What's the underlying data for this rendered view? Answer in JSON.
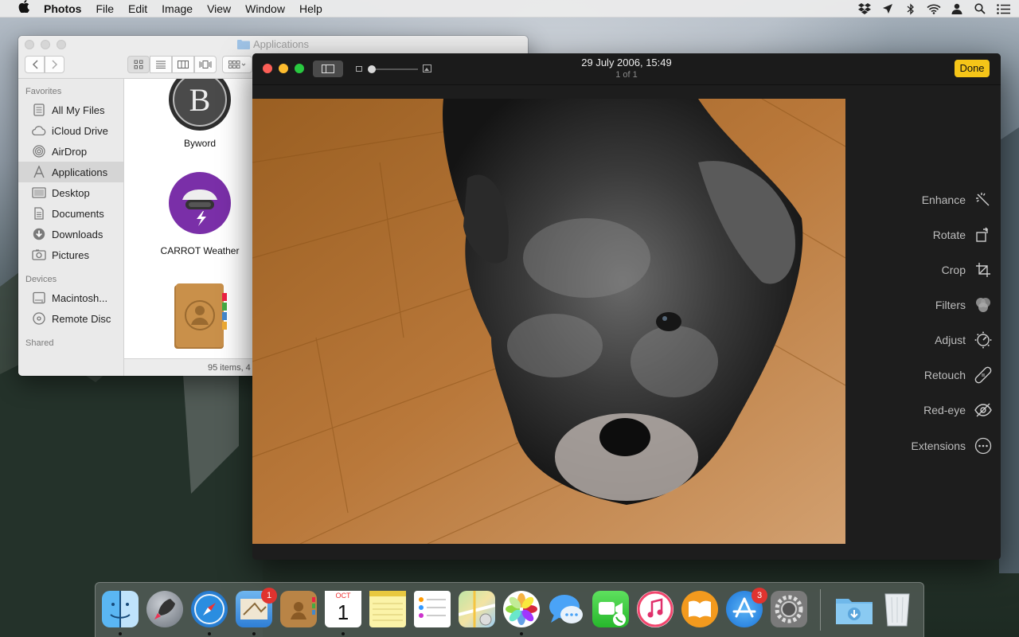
{
  "menubar": {
    "app_name": "Photos",
    "items": [
      "File",
      "Edit",
      "Image",
      "View",
      "Window",
      "Help"
    ],
    "status_icons": [
      "dropbox-icon",
      "location-icon",
      "bluetooth-icon",
      "wifi-icon",
      "user-icon",
      "spotlight-icon",
      "notification-center-icon"
    ]
  },
  "finder": {
    "title": "Applications",
    "sidebar": {
      "favorites_header": "Favorites",
      "favorites": [
        {
          "label": "All My Files",
          "icon": "all-files-icon"
        },
        {
          "label": "iCloud Drive",
          "icon": "cloud-icon"
        },
        {
          "label": "AirDrop",
          "icon": "airdrop-icon"
        },
        {
          "label": "Applications",
          "icon": "applications-icon"
        },
        {
          "label": "Desktop",
          "icon": "desktop-icon"
        },
        {
          "label": "Documents",
          "icon": "documents-icon"
        },
        {
          "label": "Downloads",
          "icon": "downloads-icon"
        },
        {
          "label": "Pictures",
          "icon": "pictures-icon"
        }
      ],
      "devices_header": "Devices",
      "devices": [
        {
          "label": "Macintosh...",
          "icon": "disk-icon"
        },
        {
          "label": "Remote Disc",
          "icon": "remote-disc-icon"
        }
      ],
      "shared_header": "Shared"
    },
    "apps": [
      {
        "label": "Byword",
        "icon": "byword-icon"
      },
      {
        "label": "CARROT Weather",
        "icon": "carrot-weather-icon"
      },
      {
        "label": "",
        "icon": "contacts-icon"
      }
    ],
    "status": "95 items, 4"
  },
  "photos": {
    "date": "29 July 2006, 15:49",
    "count": "1 of 1",
    "done_label": "Done",
    "tools": [
      {
        "label": "Enhance",
        "icon": "magic-wand-icon"
      },
      {
        "label": "Rotate",
        "icon": "rotate-icon"
      },
      {
        "label": "Crop",
        "icon": "crop-icon"
      },
      {
        "label": "Filters",
        "icon": "filters-icon"
      },
      {
        "label": "Adjust",
        "icon": "adjust-icon"
      },
      {
        "label": "Retouch",
        "icon": "bandage-icon"
      },
      {
        "label": "Red-eye",
        "icon": "red-eye-icon"
      },
      {
        "label": "Extensions",
        "icon": "more-icon"
      }
    ]
  },
  "dock": {
    "apps": [
      {
        "name": "Finder",
        "running": true
      },
      {
        "name": "Launchpad",
        "running": false
      },
      {
        "name": "Safari",
        "running": true
      },
      {
        "name": "Mail",
        "running": true,
        "badge": "1"
      },
      {
        "name": "Contacts",
        "running": false
      },
      {
        "name": "Calendar",
        "running": true,
        "month": "OCT",
        "day": "1"
      },
      {
        "name": "Notes",
        "running": false
      },
      {
        "name": "Reminders",
        "running": false
      },
      {
        "name": "Maps",
        "running": false
      },
      {
        "name": "Photos",
        "running": true
      },
      {
        "name": "Messages",
        "running": false
      },
      {
        "name": "FaceTime",
        "running": false
      },
      {
        "name": "iTunes",
        "running": false
      },
      {
        "name": "iBooks",
        "running": false
      },
      {
        "name": "App Store",
        "running": false,
        "badge": "3"
      },
      {
        "name": "System Preferences",
        "running": false
      },
      {
        "name": "Downloads",
        "running": false
      },
      {
        "name": "Trash",
        "running": false
      }
    ]
  }
}
